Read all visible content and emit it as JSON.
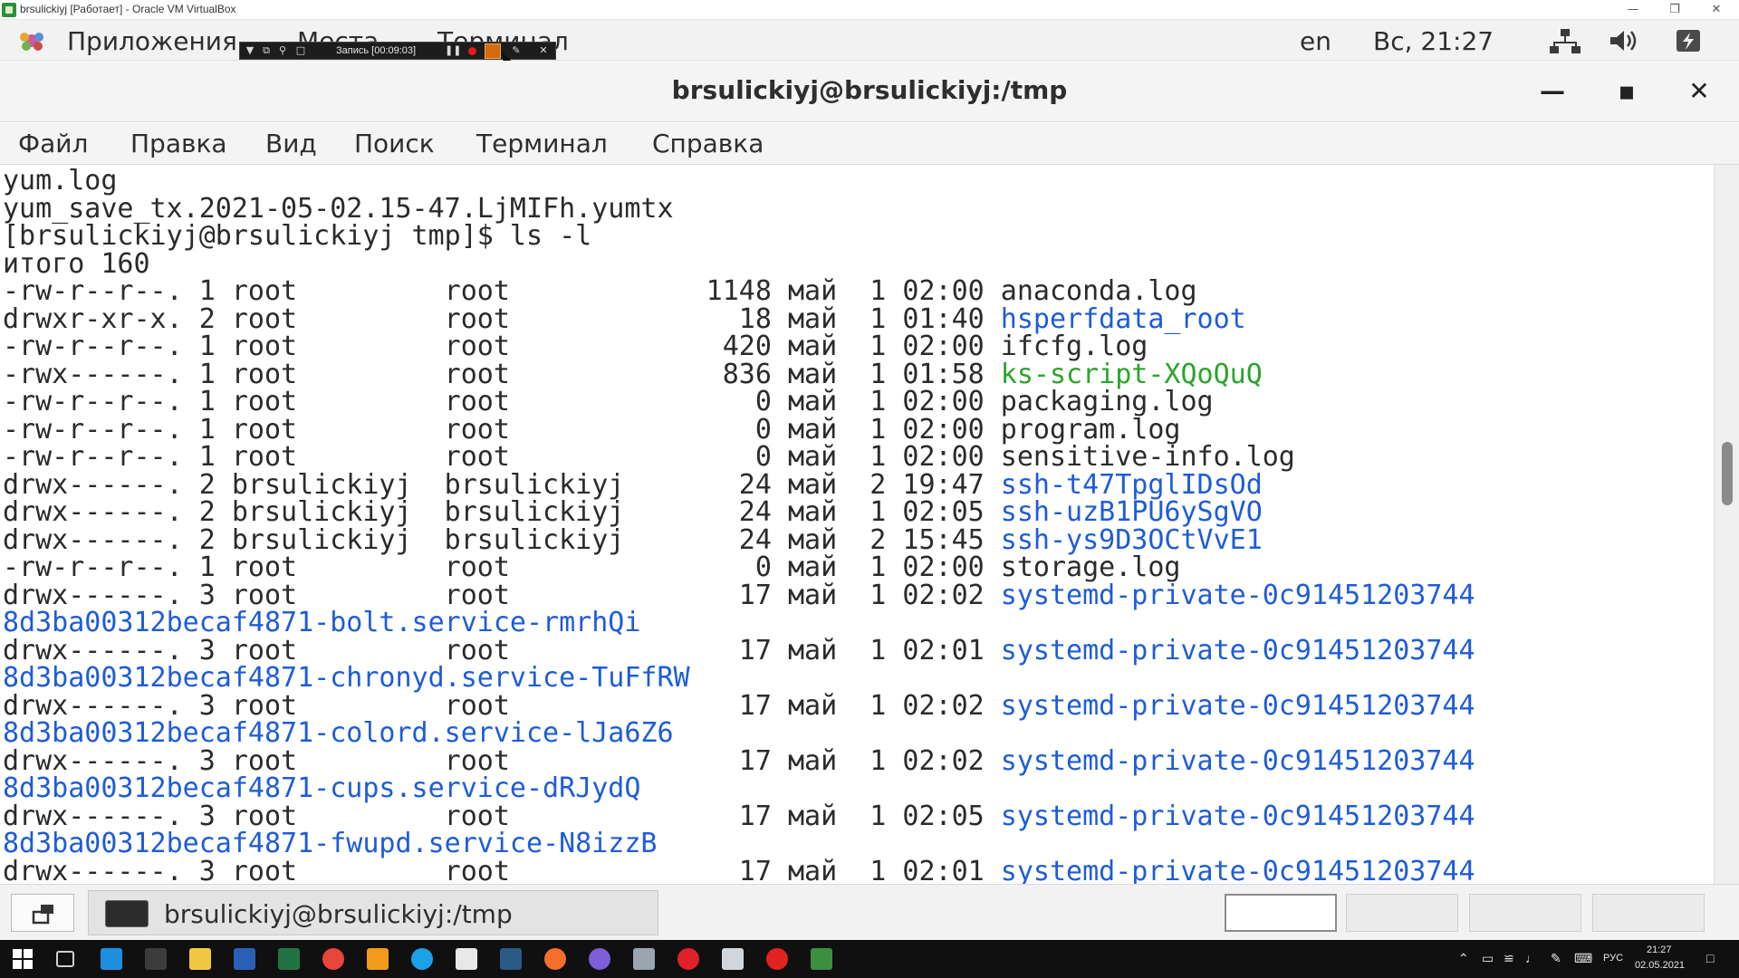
{
  "host_window": {
    "title": "brsulickiyj [Работает] - Oracle VM VirtualBox",
    "minimize_icon": "minimize-icon",
    "restore_icon": "restore-icon",
    "close_icon": "close-icon"
  },
  "gnome_panel": {
    "apps_label": "Приложения",
    "places_label": "Места",
    "terminal_label": "Терминал",
    "lang": "en",
    "clock": "Вс, 21:27",
    "icons": [
      "network-icon",
      "volume-icon",
      "power-icon"
    ]
  },
  "recorder": {
    "label": "Запись [00:09:03]"
  },
  "terminal": {
    "title": "brsulickiyj@brsulickiyj:/tmp",
    "menu": [
      "Файл",
      "Правка",
      "Вид",
      "Поиск",
      "Терминал",
      "Справка"
    ],
    "lines": [
      {
        "type": "plain",
        "text": "yum.log"
      },
      {
        "type": "plain",
        "text": "yum_save_tx.2021-05-02.15-47.LjMIFh.yumtx"
      },
      {
        "type": "plain",
        "text": "[brsulickiyj@brsulickiyj tmp]$ ls -l"
      },
      {
        "type": "plain",
        "text": "итого 160"
      },
      {
        "type": "entry",
        "meta": "-rw-r--r--. 1 root         root            1148 май  1 02:00 ",
        "name": "anaconda.log",
        "kind": "file"
      },
      {
        "type": "entry",
        "meta": "drwxr-xr-x. 2 root         root              18 май  1 01:40 ",
        "name": "hsperfdata_root",
        "kind": "dir"
      },
      {
        "type": "entry",
        "meta": "-rw-r--r--. 1 root         root             420 май  1 02:00 ",
        "name": "ifcfg.log",
        "kind": "file"
      },
      {
        "type": "entry",
        "meta": "-rwx------. 1 root         root             836 май  1 01:58 ",
        "name": "ks-script-XQoQuQ",
        "kind": "exe"
      },
      {
        "type": "entry",
        "meta": "-rw-r--r--. 1 root         root               0 май  1 02:00 ",
        "name": "packaging.log",
        "kind": "file"
      },
      {
        "type": "entry",
        "meta": "-rw-r--r--. 1 root         root               0 май  1 02:00 ",
        "name": "program.log",
        "kind": "file"
      },
      {
        "type": "entry",
        "meta": "-rw-r--r--. 1 root         root               0 май  1 02:00 ",
        "name": "sensitive-info.log",
        "kind": "file"
      },
      {
        "type": "entry",
        "meta": "drwx------. 2 brsulickiyj  brsulickiyj       24 май  2 19:47 ",
        "name": "ssh-t47TpglIDsOd",
        "kind": "dir"
      },
      {
        "type": "entry",
        "meta": "drwx------. 2 brsulickiyj  brsulickiyj       24 май  1 02:05 ",
        "name": "ssh-uzB1PU6ySgVO",
        "kind": "dir"
      },
      {
        "type": "entry",
        "meta": "drwx------. 2 brsulickiyj  brsulickiyj       24 май  2 15:45 ",
        "name": "ssh-ys9D3OCtVvE1",
        "kind": "dir"
      },
      {
        "type": "entry",
        "meta": "-rw-r--r--. 1 root         root               0 май  1 02:00 ",
        "name": "storage.log",
        "kind": "file"
      },
      {
        "type": "entry",
        "meta": "drwx------. 3 root         root              17 май  1 02:02 ",
        "name": "systemd-private-0c91451203744",
        "kind": "dir"
      },
      {
        "type": "wrap",
        "text": "8d3ba00312becaf4871-bolt.service-rmrhQi"
      },
      {
        "type": "entry",
        "meta": "drwx------. 3 root         root              17 май  1 02:01 ",
        "name": "systemd-private-0c91451203744",
        "kind": "dir"
      },
      {
        "type": "wrap",
        "text": "8d3ba00312becaf4871-chronyd.service-TuFfRW"
      },
      {
        "type": "entry",
        "meta": "drwx------. 3 root         root              17 май  1 02:02 ",
        "name": "systemd-private-0c91451203744",
        "kind": "dir"
      },
      {
        "type": "wrap",
        "text": "8d3ba00312becaf4871-colord.service-lJa6Z6"
      },
      {
        "type": "entry",
        "meta": "drwx------. 3 root         root              17 май  1 02:02 ",
        "name": "systemd-private-0c91451203744",
        "kind": "dir"
      },
      {
        "type": "wrap",
        "text": "8d3ba00312becaf4871-cups.service-dRJydQ"
      },
      {
        "type": "entry",
        "meta": "drwx------. 3 root         root              17 май  1 02:05 ",
        "name": "systemd-private-0c91451203744",
        "kind": "dir"
      },
      {
        "type": "wrap",
        "text": "8d3ba00312becaf4871-fwupd.service-N8izzB"
      },
      {
        "type": "entry",
        "meta": "drwx------. 3 root         root              17 май  1 02:01 ",
        "name": "systemd-private-0c91451203744",
        "kind": "dir"
      }
    ]
  },
  "bottom_panel": {
    "task_label": "brsulickiyj@brsulickiyj:/tmp",
    "workspaces": 4
  },
  "win_taskbar": {
    "lang": "РУС",
    "time": "21:27",
    "date": "02.05.2021",
    "apps": [
      "start-icon",
      "task-view-icon",
      "edge-icon",
      "terminal-app-icon",
      "file-explorer-icon",
      "word-icon",
      "excel-icon",
      "chrome-icon",
      "app-orange-icon",
      "skype-icon",
      "files-icon",
      "steam-icon",
      "firefox-icon",
      "firefox-dev-icon",
      "app-folder-icon",
      "opera-icon",
      "virtualbox-cube-icon",
      "recorder-icon",
      "virtualbox-icon"
    ]
  }
}
